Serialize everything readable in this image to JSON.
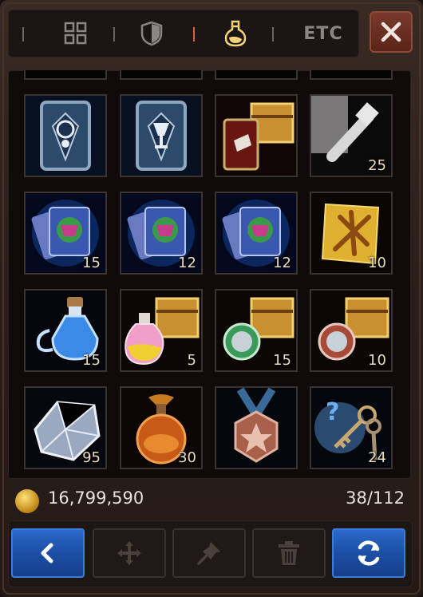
{
  "tabs": {
    "items": [
      {
        "id": "all",
        "icon": "grid-icon"
      },
      {
        "id": "equipment",
        "icon": "shield-icon"
      },
      {
        "id": "consumable",
        "icon": "potion-icon",
        "active": true
      },
      {
        "id": "etc",
        "label": "ETC"
      }
    ],
    "close_icon": "close-icon"
  },
  "inventory": {
    "items": [
      {
        "name": "tarot-card-1",
        "icon": "card-icon",
        "quantity": ""
      },
      {
        "name": "tarot-card-2",
        "icon": "chalice-card-icon",
        "quantity": ""
      },
      {
        "name": "card-chest",
        "icon": "chest-card-icon",
        "quantity": ""
      },
      {
        "name": "bolt",
        "icon": "bolt-icon",
        "quantity": "25"
      },
      {
        "name": "card-pack-1",
        "icon": "card-pack-icon",
        "quantity": "15"
      },
      {
        "name": "card-pack-2",
        "icon": "card-pack-icon",
        "quantity": "12"
      },
      {
        "name": "card-pack-3",
        "icon": "card-pack-icon",
        "quantity": "12"
      },
      {
        "name": "scroll",
        "icon": "scroll-icon",
        "quantity": "10"
      },
      {
        "name": "blue-potion",
        "icon": "blue-potion-icon",
        "quantity": "15"
      },
      {
        "name": "potion-chest",
        "icon": "potion-chest-icon",
        "quantity": "5"
      },
      {
        "name": "green-coin-chest",
        "icon": "coin-chest-icon",
        "quantity": "15"
      },
      {
        "name": "red-coin-chest",
        "icon": "coin-chest-icon",
        "quantity": "10"
      },
      {
        "name": "crystal",
        "icon": "crystal-icon",
        "quantity": "95"
      },
      {
        "name": "orange-potion",
        "icon": "orange-potion-icon",
        "quantity": "30"
      },
      {
        "name": "medal",
        "icon": "medal-icon",
        "quantity": ""
      },
      {
        "name": "mystery-keys",
        "icon": "keys-icon",
        "quantity": "24"
      }
    ]
  },
  "footer": {
    "gold_icon": "gold-coin-icon",
    "gold": "16,799,590",
    "slots": "38/112"
  },
  "toolbar": {
    "buttons": [
      {
        "id": "back",
        "icon": "chevron-left-icon"
      },
      {
        "id": "move",
        "icon": "move-icon"
      },
      {
        "id": "pin",
        "icon": "pin-icon"
      },
      {
        "id": "delete",
        "icon": "trash-icon"
      },
      {
        "id": "sort",
        "icon": "refresh-icon"
      }
    ]
  },
  "colors": {
    "accent_tab": "#d9663a",
    "primary_button": "#2b69c8",
    "close_button": "#7a3a2c"
  }
}
